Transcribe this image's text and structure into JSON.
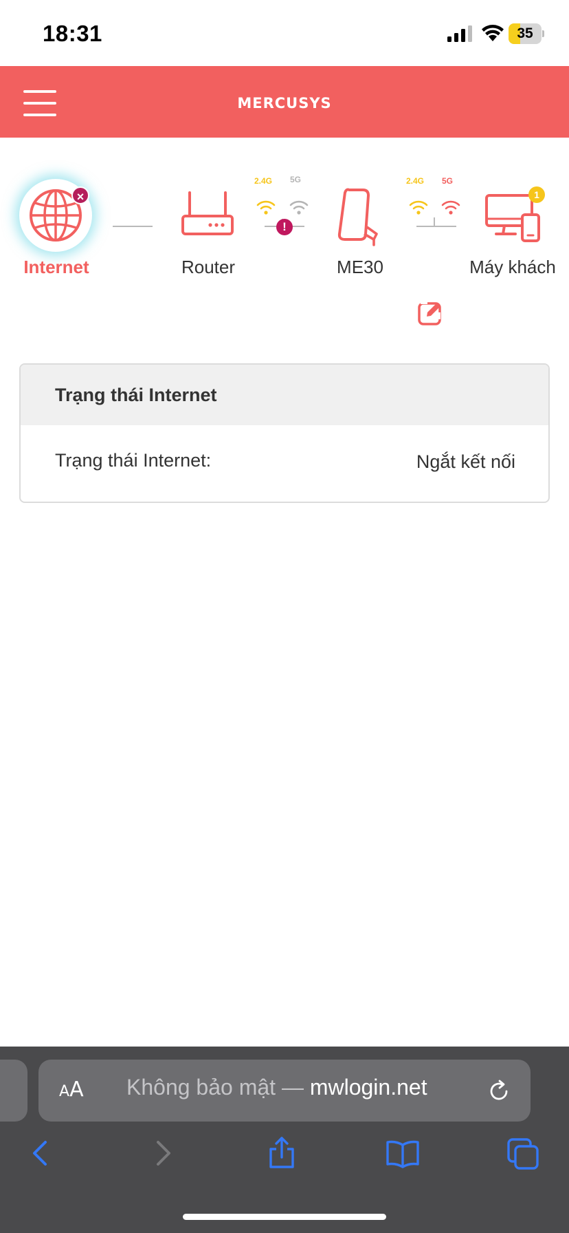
{
  "status_bar": {
    "time": "18:31",
    "battery_percent": "35",
    "battery_level": 0.35
  },
  "header": {
    "brand": "MERCUSYS"
  },
  "topology": {
    "nodes": [
      {
        "label": "Internet"
      },
      {
        "label": "Router"
      },
      {
        "label": "ME30"
      },
      {
        "label": "Máy khách"
      }
    ],
    "router_bands": {
      "band_24": "2.4G",
      "band_5": "5G"
    },
    "extender_bands": {
      "band_24": "2.4G",
      "band_5": "5G"
    },
    "internet_error_badge": "×",
    "warning_badge": "!",
    "client_count": "1"
  },
  "status_card": {
    "title": "Trạng thái Internet",
    "row_label": "Trạng thái Internet:",
    "row_value": "Ngắt kết nối"
  },
  "browser": {
    "aa_label_small": "A",
    "aa_label_large": "A",
    "url_prefix": "Không bảo mật — ",
    "url_host": "mwlogin.net"
  },
  "colors": {
    "brand_red": "#f2605f",
    "band_24_color": "#f6c51b",
    "band_5_active": "#f2605f",
    "band_5_inactive": "#b5b5b5",
    "warning": "#c0185e",
    "ios_blue": "#3478f6"
  }
}
